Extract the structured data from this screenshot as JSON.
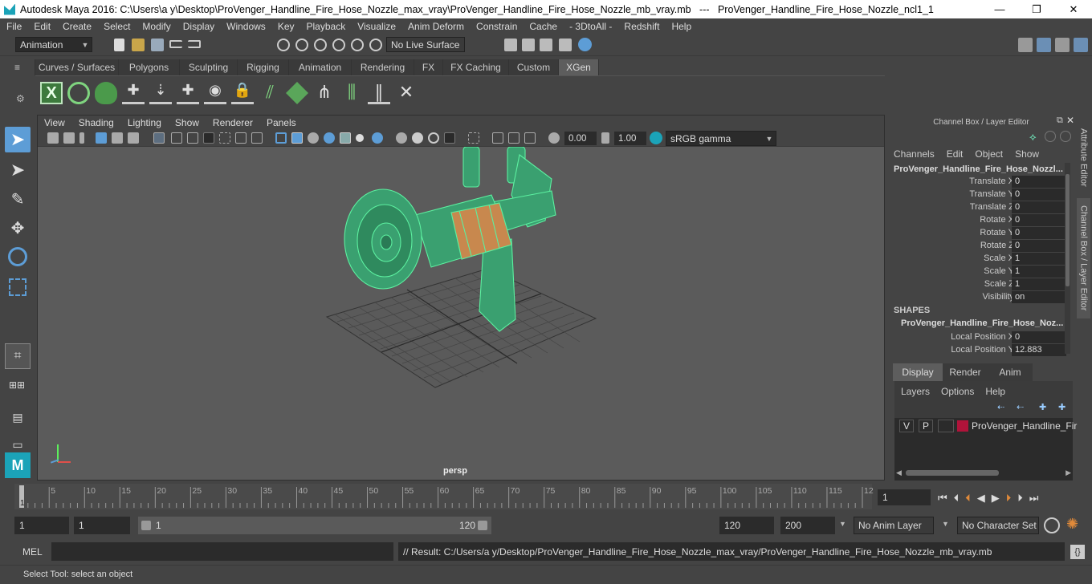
{
  "title": "Autodesk Maya 2016: C:\\Users\\a y\\Desktop\\ProVenger_Handline_Fire_Hose_Nozzle_max_vray\\ProVenger_Handline_Fire_Hose_Nozzle_mb_vray.mb   ---   ProVenger_Handline_Fire_Hose_Nozzle_ncl1_1",
  "window_buttons": [
    "—",
    "❐",
    "✕"
  ],
  "menu": [
    "File",
    "Edit",
    "Create",
    "Select",
    "Modify",
    "Display",
    "Windows",
    "Key",
    "Playback",
    "Visualize",
    "Anim Deform",
    "Constrain",
    "Cache",
    "- 3DtoAll -",
    "Redshift",
    "Help"
  ],
  "statusline": {
    "menu_set": "Animation",
    "live_surface": "No Live Surface"
  },
  "shelf_tabs": [
    "Curves / Surfaces",
    "Polygons",
    "Sculpting",
    "Rigging",
    "Animation",
    "Rendering",
    "FX",
    "FX Caching",
    "Custom",
    "XGen"
  ],
  "active_shelf_tab": "XGen",
  "viewport": {
    "menu": [
      "View",
      "Shading",
      "Lighting",
      "Show",
      "Renderer",
      "Panels"
    ],
    "exposure": "0.00",
    "gamma": "1.00",
    "color_space": "sRGB gamma",
    "camera_label": "persp"
  },
  "channel_box": {
    "panel_title": "Channel Box / Layer Editor",
    "menu": [
      "Channels",
      "Edit",
      "Object",
      "Show"
    ],
    "object_name": "ProVenger_Handline_Fire_Hose_Nozzl...",
    "attributes": [
      {
        "label": "Translate X",
        "value": "0"
      },
      {
        "label": "Translate Y",
        "value": "0"
      },
      {
        "label": "Translate Z",
        "value": "0"
      },
      {
        "label": "Rotate X",
        "value": "0"
      },
      {
        "label": "Rotate Y",
        "value": "0"
      },
      {
        "label": "Rotate Z",
        "value": "0"
      },
      {
        "label": "Scale X",
        "value": "1"
      },
      {
        "label": "Scale Y",
        "value": "1"
      },
      {
        "label": "Scale Z",
        "value": "1"
      },
      {
        "label": "Visibility",
        "value": "on"
      }
    ],
    "shapes_header": "SHAPES",
    "shape_name": "ProVenger_Handline_Fire_Hose_Noz...",
    "shape_attributes": [
      {
        "label": "Local Position X",
        "value": "0"
      },
      {
        "label": "Local Position Y",
        "value": "12.883"
      }
    ]
  },
  "side_tabs": [
    "Attribute Editor",
    "Channel Box / Layer Editor"
  ],
  "layer_editor": {
    "tabs": [
      "Display",
      "Render",
      "Anim"
    ],
    "active_tab": "Display",
    "menu": [
      "Layers",
      "Options",
      "Help"
    ],
    "layer": {
      "v": "V",
      "p": "P",
      "name": "ProVenger_Handline_Fir",
      "color": "#b0133a"
    }
  },
  "timeline": {
    "ticks": [
      "5",
      "10",
      "15",
      "20",
      "25",
      "30",
      "35",
      "40",
      "45",
      "50",
      "55",
      "60",
      "65",
      "70",
      "75",
      "80",
      "85",
      "90",
      "95",
      "100",
      "105",
      "110",
      "115",
      "12"
    ],
    "current_frame": "1",
    "frame_field": "1"
  },
  "range": {
    "start": "1",
    "playback_start": "1",
    "slider_start": "1",
    "slider_end": "120",
    "playback_end": "120",
    "end": "200",
    "anim_layer": "No Anim Layer",
    "character_set": "No Character Set"
  },
  "command_line": {
    "label": "MEL",
    "result": "// Result: C:/Users/a y/Desktop/ProVenger_Handline_Fire_Hose_Nozzle_max_vray/ProVenger_Handline_Fire_Hose_Nozzle_mb_vray.mb"
  },
  "help_line": "Select Tool: select an object",
  "colors": {
    "accent": "#5d9dd6",
    "wire": "#5cf0a0",
    "layer": "#b0133a",
    "copper": "#c8884e"
  }
}
